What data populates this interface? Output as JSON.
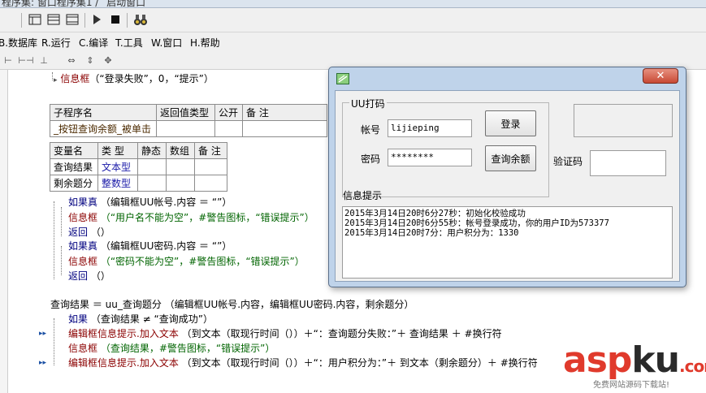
{
  "window": {
    "title": "程序集: 窗口程序集1 / _启动窗口"
  },
  "menu": [
    {
      "label": "B.数据库"
    },
    {
      "label": "R.运行"
    },
    {
      "label": "C.编译"
    },
    {
      "label": "T.工具"
    },
    {
      "label": "W.窗口"
    },
    {
      "label": "H.帮助"
    }
  ],
  "code_top": {
    "line1_func": "信息框",
    "line1_args": "（“登录失败”，0，“提示”）"
  },
  "sub_table": {
    "headers": [
      "子程序名",
      "返回值类型",
      "公开",
      "备 注"
    ],
    "row": [
      "_按钮查询余额_被单击",
      "",
      "",
      ""
    ]
  },
  "var_table": {
    "headers": [
      "变量名",
      "类 型",
      "静态",
      "数组",
      "备 注"
    ],
    "rows": [
      [
        "查询结果",
        "文本型",
        "",
        "",
        ""
      ],
      [
        "剩余题分",
        "整数型",
        "",
        "",
        ""
      ]
    ]
  },
  "code_lines": [
    {
      "kw": "如果真",
      "rest": "（编辑框UU帐号.内容 ＝ “”）"
    },
    {
      "kw": "信息框",
      "rest": "（“用户名不能为空”，#警告图标，“错误提示”）"
    },
    {
      "kw": "返回",
      "rest": "（）"
    },
    {
      "kw": "如果真",
      "rest": "（编辑框UU密码.内容 ＝ “”）"
    },
    {
      "kw": "信息框",
      "rest": "（“密码不能为空”，#警告图标，“错误提示”）"
    },
    {
      "kw": "返回",
      "rest": "（）"
    },
    {
      "kw": "查询结果 ＝ uu_查询题分",
      "rest": "（编辑框UU帐号.内容，编辑框UU密码.内容，剩余题分）"
    },
    {
      "kw": "如果",
      "rest": "（查询结果 ≠ “查询成功”）"
    },
    {
      "kw": "编辑框信息提示.加入文本",
      "rest": "（到文本（取现行时间（））＋“：查询题分失败：”＋ 查询结果 ＋ #换行符"
    },
    {
      "kw": "信息框",
      "rest": "（查询结果，#警告图标，“错误提示”）"
    },
    {
      "kw": "编辑框信息提示.加入文本",
      "rest": "（到文本（取现行时间（））＋“：用户积分为：”＋ 到文本（剩余题分）＋ #换行符"
    }
  ],
  "dialog": {
    "group_title": "UU打码",
    "account_label": "帐号",
    "account_value": "lijieping",
    "password_label": "密码",
    "password_value": "********",
    "login_button": "登录",
    "query_button": "查询余额",
    "captcha_label": "验证码",
    "captcha_value": "",
    "info_label": "信息提示",
    "log_lines": [
      "2015年3月14日20时6分27秒：初始化校验成功",
      "2015年3月14日20时6分55秒：帐号登录成功，你的用户ID为573377",
      "2015年3月14日20时7分：用户积分为：1330"
    ]
  },
  "watermark": {
    "asp": "asp",
    "ku": "ku",
    "domain": ".com",
    "sub": "免费网站源码下载站!"
  },
  "colors": {
    "keyword": "#8b0000",
    "string": "#006400",
    "type": "#1a1aa8",
    "close_button": "#c84a35"
  }
}
